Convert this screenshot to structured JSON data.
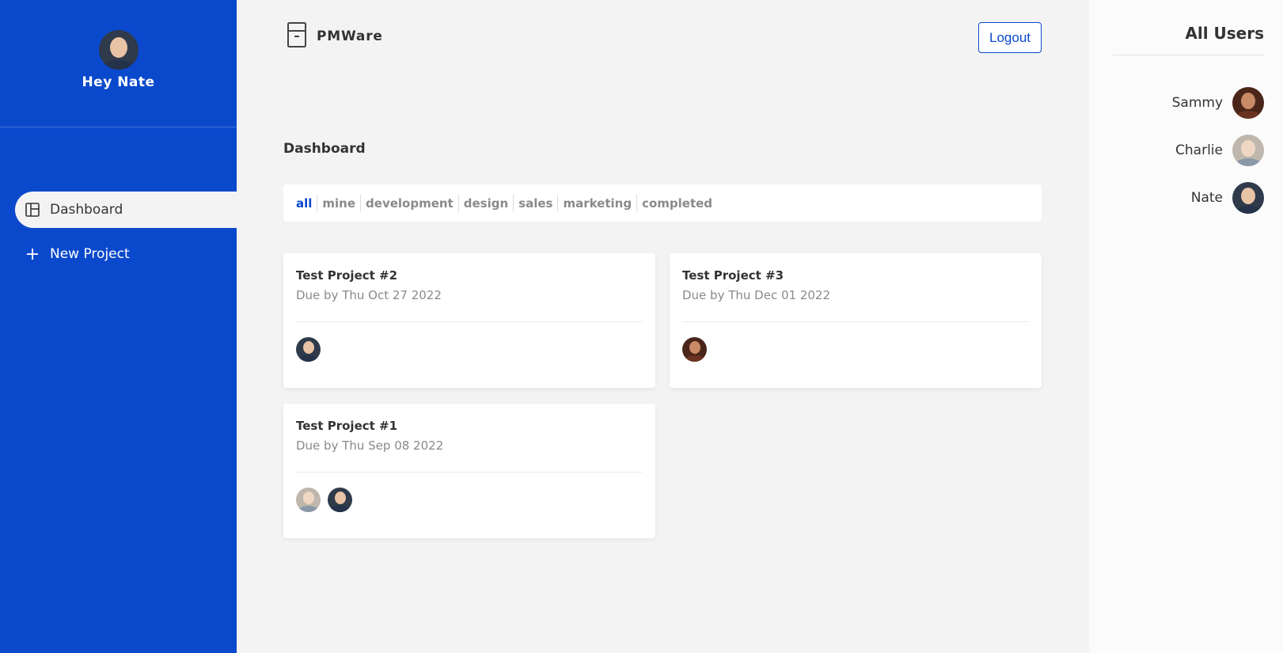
{
  "sidebar": {
    "greeting": "Hey Nate",
    "nav": [
      {
        "label": "Dashboard",
        "icon": "dashboard-icon",
        "active": true
      },
      {
        "label": "New Project",
        "icon": "plus-icon",
        "active": false
      }
    ]
  },
  "header": {
    "brand": "PMWare",
    "logout_label": "Logout"
  },
  "main": {
    "title": "Dashboard",
    "filters": [
      "all",
      "mine",
      "development",
      "design",
      "sales",
      "marketing",
      "completed"
    ],
    "active_filter": "all",
    "projects": [
      {
        "title": "Test Project #2",
        "due": "Due by Thu Oct 27 2022",
        "assignees": [
          "Nate"
        ]
      },
      {
        "title": "Test Project #3",
        "due": "Due by Thu Dec 01 2022",
        "assignees": [
          "Sammy"
        ]
      },
      {
        "title": "Test Project #1",
        "due": "Due by Thu Sep 08 2022",
        "assignees": [
          "Charlie",
          "Nate"
        ]
      }
    ]
  },
  "users_panel": {
    "title": "All Users",
    "users": [
      "Sammy",
      "Charlie",
      "Nate"
    ]
  },
  "colors": {
    "accent": "#0b49cc",
    "background": "#f3f3f3",
    "muted_text": "#8a8a8a"
  }
}
